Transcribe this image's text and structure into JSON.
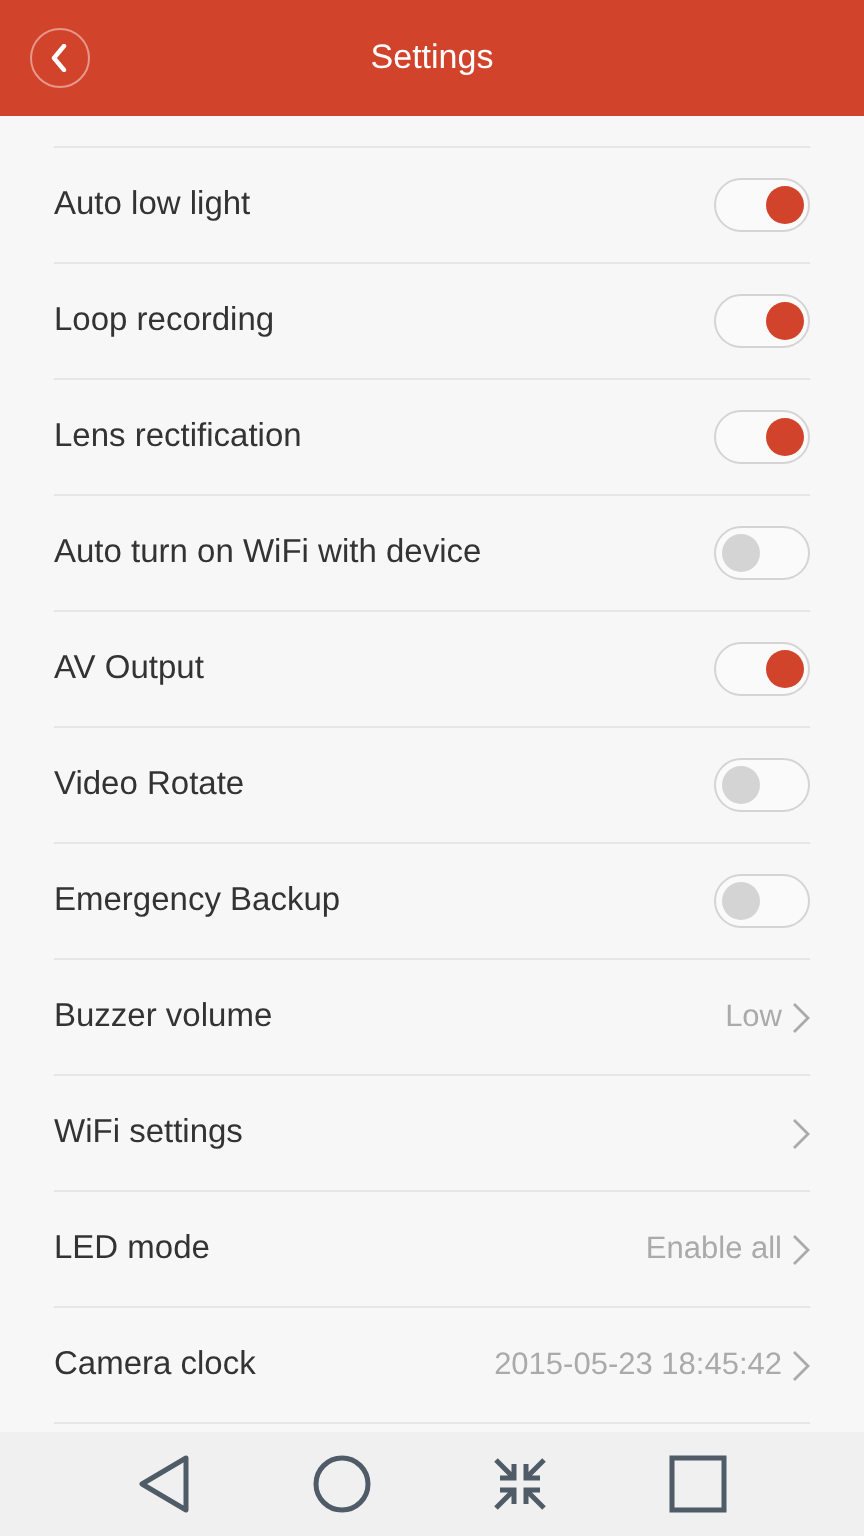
{
  "header": {
    "title": "Settings"
  },
  "rows": [
    {
      "kind": "toggle",
      "label": "Auto low light",
      "on": true
    },
    {
      "kind": "toggle",
      "label": "Loop recording",
      "on": true
    },
    {
      "kind": "toggle",
      "label": "Lens rectification",
      "on": true
    },
    {
      "kind": "toggle",
      "label": "Auto turn on WiFi with device",
      "on": false
    },
    {
      "kind": "toggle",
      "label": "AV Output",
      "on": true
    },
    {
      "kind": "toggle",
      "label": "Video Rotate",
      "on": false
    },
    {
      "kind": "toggle",
      "label": "Emergency Backup",
      "on": false
    },
    {
      "kind": "link",
      "label": "Buzzer volume",
      "value": "Low"
    },
    {
      "kind": "link",
      "label": "WiFi settings"
    },
    {
      "kind": "link",
      "label": "LED mode",
      "value": "Enable all"
    },
    {
      "kind": "link",
      "label": "Camera clock",
      "value": "2015-05-23 18:45:42"
    }
  ]
}
